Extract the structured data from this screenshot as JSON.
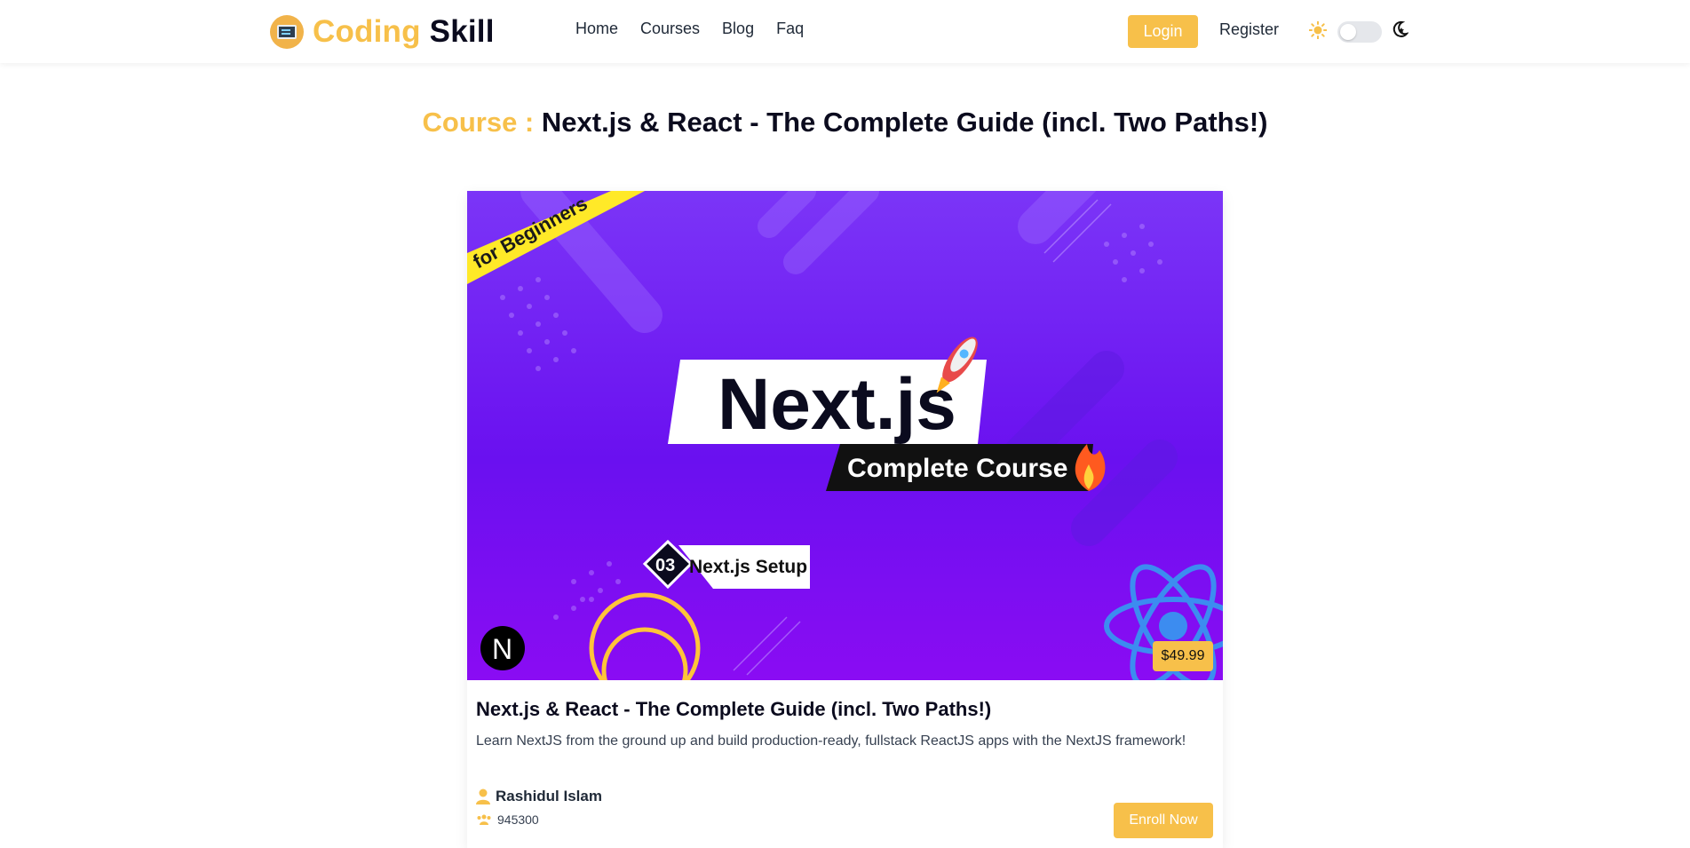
{
  "brand": {
    "part1": "Coding",
    "part2": "Skill"
  },
  "nav": {
    "items": [
      "Home",
      "Courses",
      "Blog",
      "Faq"
    ]
  },
  "auth": {
    "login_label": "Login",
    "register_label": "Register"
  },
  "theme": {
    "mode": "light"
  },
  "heading": {
    "prefix": "Course :",
    "title": "Next.js & React - The Complete Guide (incl. Two Paths!)"
  },
  "banner": {
    "ribbon": "for Beginners",
    "main_title": "Next.js",
    "subtitle": "Complete Course",
    "lesson_number": "03",
    "lesson_title": "Next.js Setup",
    "logo_letter": "N"
  },
  "course": {
    "price": "$49.99",
    "title": "Next.js & React - The Complete Guide (incl. Two Paths!)",
    "description": "Learn NextJS from the ground up and build production-ready, fullstack ReactJS apps with the NextJS framework!",
    "author": "Rashidul Islam",
    "students": "945300",
    "enroll_label": "Enroll Now"
  },
  "colors": {
    "accent": "#f7c04a",
    "dark": "#0b0b1e",
    "banner_purple": "#7b35f7"
  }
}
